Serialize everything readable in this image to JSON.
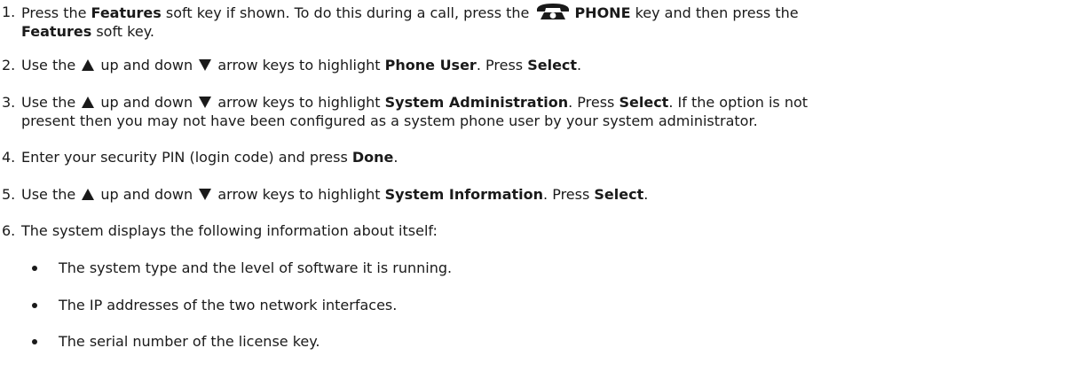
{
  "steps": [
    {
      "num": "1.",
      "a": "Press the ",
      "b1": "Features",
      "c": " soft key if shown. To do this during a call, press the ",
      "b2": "PHONE",
      "d": " key and then press the",
      "b3": "Features",
      "e": " soft key."
    },
    {
      "num": "2.",
      "a": "Use the ",
      "b": " up and down ",
      "c": " arrow keys to highlight ",
      "bold1": "Phone User",
      "d": ". Press ",
      "bold2": "Select",
      "e": "."
    },
    {
      "num": "3.",
      "a": "Use the ",
      "b": " up and down ",
      "c": " arrow keys to highlight ",
      "bold1": "System Administration",
      "d": ". Press ",
      "bold2": "Select",
      "e": ". If the option is not",
      "line2": "present then you may not have been configured as a system phone user by your system administrator."
    },
    {
      "num": "4.",
      "a": "Enter your security PIN (login code) and press ",
      "bold1": "Done",
      "e": "."
    },
    {
      "num": "5.",
      "a": "Use the ",
      "b": " up and down ",
      "c": " arrow keys to highlight ",
      "bold1": "System Information",
      "d": ". Press ",
      "bold2": "Select",
      "e": "."
    },
    {
      "num": "6.",
      "a": "The system displays the following information about itself:"
    }
  ],
  "bullets": [
    "The system type and the level of software it is running.",
    "The IP addresses of the two network interfaces.",
    "The serial number of the license key."
  ],
  "icons": {
    "phone": "phone-icon",
    "up": "up-arrow-icon",
    "down": "down-arrow-icon"
  }
}
